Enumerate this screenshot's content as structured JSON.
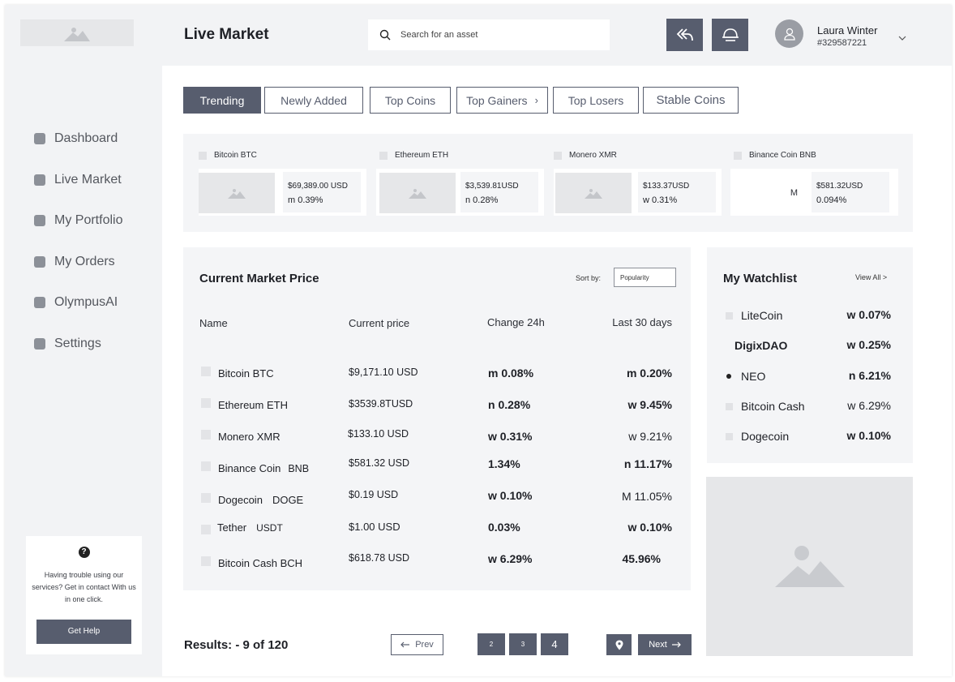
{
  "header": {
    "title": "Live Market",
    "search_placeholder": "Search for an asset",
    "user": {
      "name": "Laura Winter",
      "id": "#329587221"
    }
  },
  "sidebar": {
    "items": [
      {
        "label": "Dashboard"
      },
      {
        "label": "Live Market"
      },
      {
        "label": "My Portfolio"
      },
      {
        "label": "My Orders"
      },
      {
        "label": "OlympusAI"
      },
      {
        "label": "Settings"
      }
    ],
    "help": {
      "icon": "?",
      "text": "Having trouble using our services? Get in contact With us in one click.",
      "button": "Get Help"
    }
  },
  "tabs": [
    {
      "label": "Trending",
      "active": true
    },
    {
      "label": "Newly Added"
    },
    {
      "label": "Top Coins"
    },
    {
      "label": "Top Gainers",
      "suffix": "›"
    },
    {
      "label": "Top Losers"
    },
    {
      "label": "Stable Coins"
    }
  ],
  "featured": [
    {
      "name": "Bitcoin BTC",
      "price": "$69,389.00 USD",
      "change": "m 0.39%"
    },
    {
      "name": "Ethereum ETH",
      "price": "$3,539.81USD",
      "change": "n 0.28%"
    },
    {
      "name": "Monero XMR",
      "price": "$133.37USD",
      "change": "w 0.31%"
    },
    {
      "name": "Binance Coin BNB",
      "img_text": "M",
      "price": "$581.32USD",
      "change": "0.094%"
    }
  ],
  "market": {
    "title": "Current Market Price",
    "sort_label": "Sort by:",
    "sort_value": "Popularity",
    "columns": {
      "name": "Name",
      "price": "Current price",
      "change24": "Change 24h",
      "change30": "Last 30 days"
    },
    "rows": [
      {
        "name": "Bitcoin BTC",
        "ticker": "",
        "price": "$9,171.10 USD",
        "change24": "m 0.08%",
        "change30": "m 0.20%"
      },
      {
        "name": "Ethereum ETH",
        "ticker": "",
        "price": "$3539.8TUSD",
        "change24": "n 0.28%",
        "change30": "w 9.45%"
      },
      {
        "name": "Monero XMR",
        "ticker": "",
        "price": "$133.10 USD",
        "change24": "w 0.31%",
        "change30": "w 9.21%"
      },
      {
        "name": "Binance Coin",
        "ticker": "BNB",
        "price": "$581.32 USD",
        "change24": "1.34%",
        "change30": "n 11.17%"
      },
      {
        "name": "Dogecoin",
        "ticker": "DOGE",
        "price": "$0.19 USD",
        "change24": "w 0.10%",
        "change30": "M 11.05%"
      },
      {
        "name": "Tether",
        "ticker": "USDT",
        "price": "$1.00 USD",
        "change24": "0.03%",
        "change30": "w 0.10%"
      },
      {
        "name": "Bitcoin Cash BCH",
        "ticker": "",
        "price": "$618.78 USD",
        "change24": "w 6.29%",
        "change30": "45.96%"
      }
    ]
  },
  "pagination": {
    "results": "Results: - 9 of 120",
    "prev": "Prev",
    "pages": [
      "2",
      "3",
      "4"
    ],
    "next": "Next"
  },
  "watchlist": {
    "title": "My Watchlist",
    "view_all": "View All >",
    "items": [
      {
        "name": "LiteCoin",
        "value": "w 0.07%"
      },
      {
        "name": "DigixDAO",
        "value": "w 0.25%"
      },
      {
        "name": "NEO",
        "value": "n 6.21%"
      },
      {
        "name": "Bitcoin Cash",
        "value": "w 6.29%"
      },
      {
        "name": "Dogecoin",
        "value": "w 0.10%"
      }
    ]
  },
  "colors": {
    "accent": "#575d6e",
    "panel": "#f4f5f7",
    "placeholder": "#e6e7e9"
  },
  "icons": [
    "image-placeholder-icon",
    "search-icon",
    "reply-all-icon",
    "bell-icon",
    "user-icon",
    "chevron-down-icon",
    "question-icon",
    "arrow-left-icon",
    "arrow-right-icon",
    "location-pin-icon"
  ]
}
